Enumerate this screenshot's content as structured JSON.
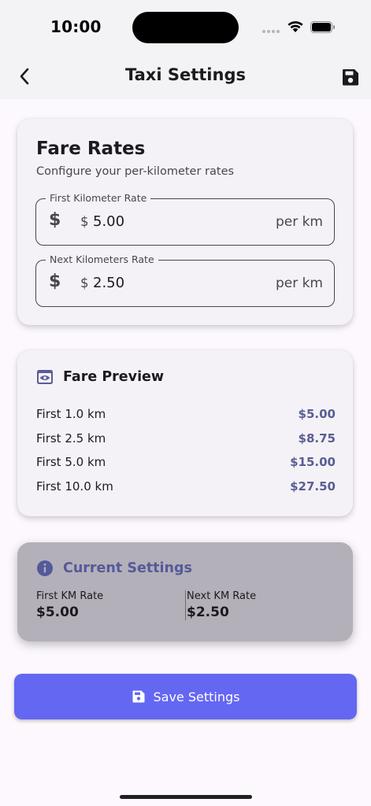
{
  "status_bar": {
    "time": "10:00"
  },
  "app_bar": {
    "title": "Taxi Settings"
  },
  "fare_rates": {
    "title": "Fare Rates",
    "subtitle": "Configure your per-kilometer rates",
    "fields": [
      {
        "label": "First Kilometer Rate",
        "prefix": "$",
        "value": "5.00",
        "suffix": "per km"
      },
      {
        "label": "Next Kilometers Rate",
        "prefix": "$",
        "value": "2.50",
        "suffix": "per km"
      }
    ]
  },
  "fare_preview": {
    "title": "Fare Preview",
    "rows": [
      {
        "label": "First 1.0 km",
        "amount": "$5.00"
      },
      {
        "label": "First 2.5 km",
        "amount": "$8.75"
      },
      {
        "label": "First 5.0 km",
        "amount": "$15.00"
      },
      {
        "label": "First 10.0 km",
        "amount": "$27.50"
      }
    ]
  },
  "current_settings": {
    "title": "Current Settings",
    "first": {
      "label": "First KM Rate",
      "value": "$5.00"
    },
    "next": {
      "label": "Next KM Rate",
      "value": "$2.50"
    }
  },
  "save_button": {
    "label": "Save Settings"
  },
  "colors": {
    "accent": "#6467f2",
    "preview_amount": "#5a5d94",
    "current_title": "#545a9a",
    "current_card_bg": "#b3b0b9",
    "background": "#fcf8fd"
  },
  "icons": {
    "back": "chevron-left-icon",
    "save": "floppy-disk-icon",
    "preview": "eye-window-icon",
    "info": "info-circle-icon",
    "dollar": "dollar-icon"
  }
}
